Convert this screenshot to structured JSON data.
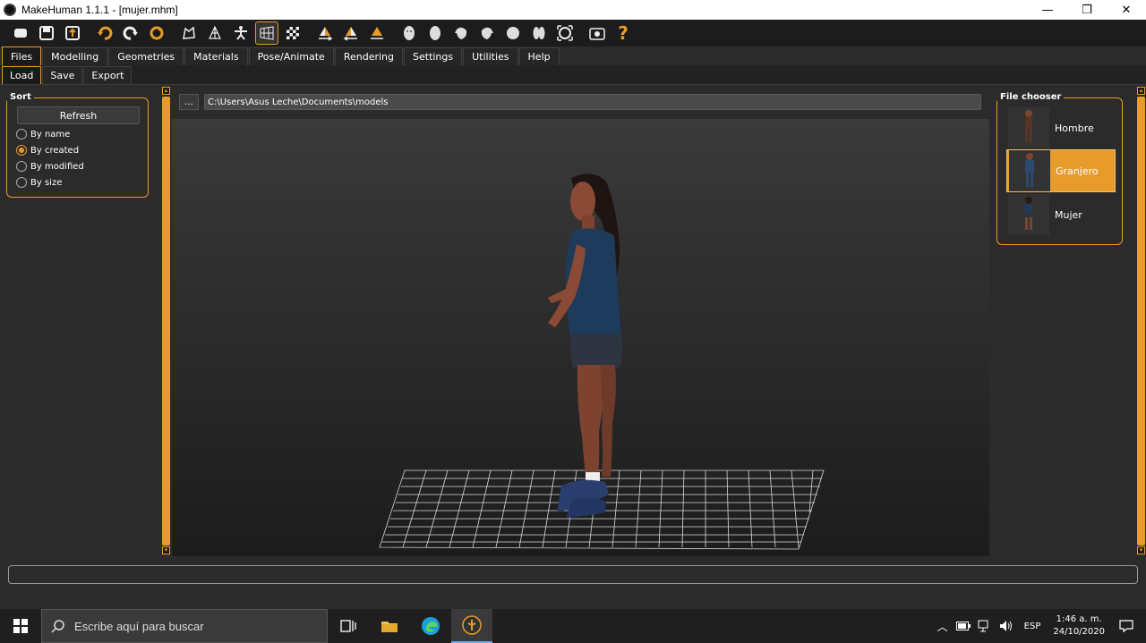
{
  "window": {
    "title": "MakeHuman 1.1.1 - [mujer.mhm]",
    "minimize": "—",
    "restore": "❐",
    "close": "✕"
  },
  "toolbar": {
    "icons": [
      "new-icon",
      "save-icon",
      "export-icon",
      "undo-icon",
      "redo-icon",
      "reset-icon",
      "smooth-icon",
      "wireframe-icon",
      "pose-icon",
      "grid-icon",
      "checker-icon",
      "symmetry-right-icon",
      "symmetry-left-icon",
      "symmetry-icon",
      "front-view-icon",
      "back-view-icon",
      "left-view-icon",
      "right-view-icon",
      "top-view-icon",
      "bottom-view-icon",
      "reset-camera-icon",
      "screenshot-icon",
      "help-icon"
    ],
    "help_label": "?"
  },
  "tabs": [
    "Files",
    "Modelling",
    "Geometries",
    "Materials",
    "Pose/Animate",
    "Rendering",
    "Settings",
    "Utilities",
    "Help"
  ],
  "subtabs": [
    "Load",
    "Save",
    "Export"
  ],
  "sort": {
    "title": "Sort",
    "refresh_label": "Refresh",
    "options": [
      "By name",
      "By created",
      "By modified",
      "By size"
    ],
    "selected": "By created"
  },
  "path": {
    "browse_label": "...",
    "value": "C:\\Users\\Asus Leche\\Documents\\models"
  },
  "file_chooser": {
    "title": "File chooser",
    "items": [
      "Hombre",
      "Granjero",
      "Mujer"
    ],
    "selected": "Granjero"
  },
  "taskbar": {
    "search_placeholder": "Escribe aquí para buscar",
    "lang": "ESP",
    "time": "1:46 a. m.",
    "date": "24/10/2020"
  },
  "colors": {
    "accent": "#e69b2b",
    "toolbar_bg": "#1c1c1c",
    "panel_bg": "#2b2b2b"
  }
}
